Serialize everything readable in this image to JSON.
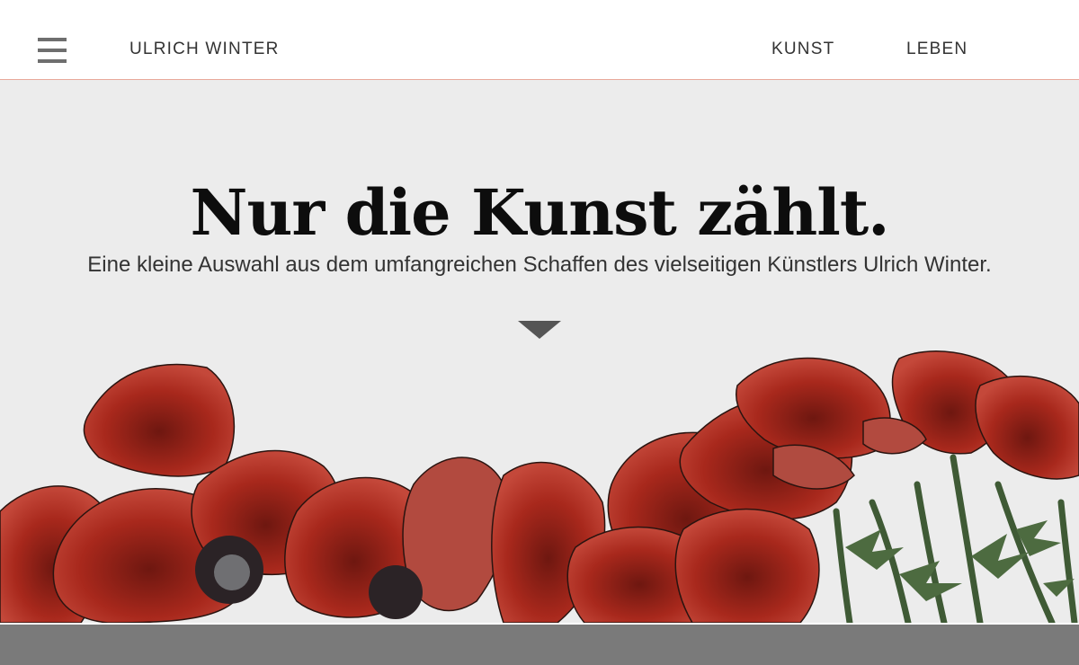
{
  "header": {
    "menu_icon": "hamburger-menu-icon",
    "brand": "ULRICH WINTER",
    "nav": [
      {
        "label": "KUNST"
      },
      {
        "label": "LEBEN"
      }
    ]
  },
  "hero": {
    "headline": "Nur die Kunst zählt.",
    "subline": "Eine kleine Auswahl aus dem umfangreichen Schaffen des vielseitigen Künstlers Ulrich Winter.",
    "scroll_icon": "triangle-down-icon",
    "image": "red-poppies-painting"
  },
  "colors": {
    "background": "#ececec",
    "header_border": "#e8a89a",
    "footer_bar": "#7a7a7a",
    "poppy_red": "#a8281c"
  }
}
